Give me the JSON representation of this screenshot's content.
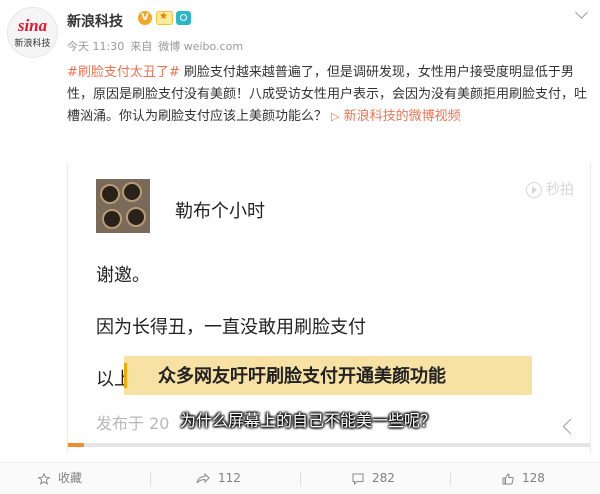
{
  "post": {
    "author": "新浪科技",
    "avatar_logo": "sina",
    "avatar_label": "新浪科技",
    "verified_badge": "V",
    "meta": {
      "time": "今天 11:30",
      "source_prefix": "来自",
      "source": "微博 weibo.com"
    },
    "text": {
      "hashtag": "#刷脸支付太丑了#",
      "body": " 刷脸支付越来越普遍了，但是调研发现，女性用户接受度明显低于男性，原因是刷脸支付没有美颜！八成受访女性用户表示，会因为没有美颜拒用刷脸支付，吐槽汹涌。你认为刷脸支付应该上美颜功能么？",
      "link_label": "新浪科技的微博视频",
      "link_icon": "video-link-icon"
    }
  },
  "video": {
    "user_name": "勒布个小时",
    "watermark": "秒拍",
    "line1": "谢邀。",
    "line2": "因为长得丑，一直没敢用刷脸支付",
    "line3_prefix": "以上",
    "subtitle_top": "众多网友吁吁刷脸支付开通美颜功能",
    "subtitle_bottom": "为什么屏幕上的自己不能美一些呢？",
    "date_prefix": "发布于 20",
    "progress": 0.03
  },
  "actions": {
    "collect_label": "收藏",
    "forward_count": "112",
    "comment_count": "282",
    "like_count": "128"
  },
  "colors": {
    "accent": "#eb7350",
    "subtitle_bg": "#f7e2a4",
    "progress": "#f08c33"
  }
}
